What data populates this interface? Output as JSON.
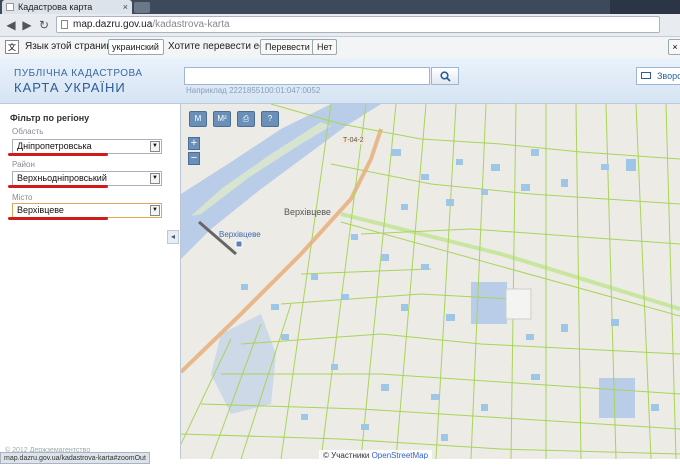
{
  "browser": {
    "tab_title": "Кадастрова карта",
    "url_host": "map.dazru.gov.ua",
    "url_path": "/kadastrova-karta",
    "status_url": "map.dazru.gov.ua/kadastrova-karta#zoomOut"
  },
  "translate_bar": {
    "prompt": "Язык этой страницы:",
    "language": "украинский",
    "question": "Хотите перевести ее?",
    "translate_label": "Перевести",
    "no_label": "Нет",
    "close_label": "×"
  },
  "header": {
    "brand_line1": "ПУБЛІЧНА КАДАСТРОВА",
    "brand_line2": "КАРТА УКРАЇНИ",
    "search_value": "",
    "search_hint": "Наприклад 2221855100:01:047:0052",
    "feedback_label": "Зворо"
  },
  "sidebar": {
    "title": "Фільтр по регіону",
    "region_label": "Область",
    "region_value": "Дніпропетровська",
    "district_label": "Район",
    "district_value": "Верхньодніпровський",
    "city_label": "Місто",
    "city_value": "Верхівцеве",
    "copyright": "© 2012 Держземагентство"
  },
  "map": {
    "tool_labels": [
      "M",
      "M²",
      "⎙",
      "?"
    ],
    "zoom_in": "+",
    "zoom_out": "−",
    "place_label": "Верхівцеве",
    "place_label_small": "Верхівцеве",
    "road_label": "Т-04-2",
    "attribution_prefix": "© Участники",
    "attribution_link": "OpenStreetMap"
  },
  "colors": {
    "parcel_line": "#a8d45a",
    "building": "#9ec6e6",
    "river": "#b9cde8",
    "road": "#e9b88a",
    "highlight": "#d21a1a"
  }
}
